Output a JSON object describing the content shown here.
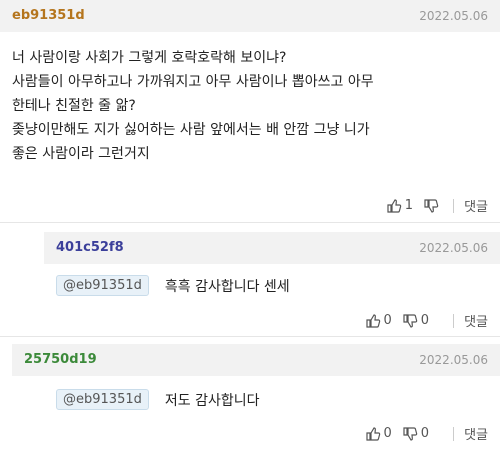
{
  "comments": [
    {
      "author": "eb91351d",
      "author_color": "#b5751d",
      "date": "2022.05.06",
      "lines": [
        "너 사람이랑 사회가 그렇게 호락호락해 보이냐?",
        "사람들이 아무하고나 가까워지고 아무 사람이나 뽑아쓰고 아무",
        "한테나 친절한 줄 앎?",
        "좆냥이만해도 지가 싫어하는 사람 앞에서는 배 안깜 그냥 니가",
        "좋은 사람이라 그런거지"
      ],
      "likes": "1",
      "dislikes": "",
      "reply_label": "댓글"
    },
    {
      "author": "401c52f8",
      "author_color": "#3b3f9a",
      "date": "2022.05.06",
      "mention": "@eb91351d",
      "text": "흑흑 감사합니다 센세",
      "likes": "0",
      "dislikes": "0",
      "reply_label": "댓글"
    },
    {
      "author": "25750d19",
      "author_color": "#3c8a3a",
      "date": "2022.05.06",
      "mention": "@eb91351d",
      "text": "저도 감사합니다",
      "likes": "0",
      "dislikes": "0",
      "reply_label": "댓글"
    }
  ],
  "icons": {
    "like": "thumbs-up-icon",
    "dislike": "thumbs-down-icon"
  }
}
